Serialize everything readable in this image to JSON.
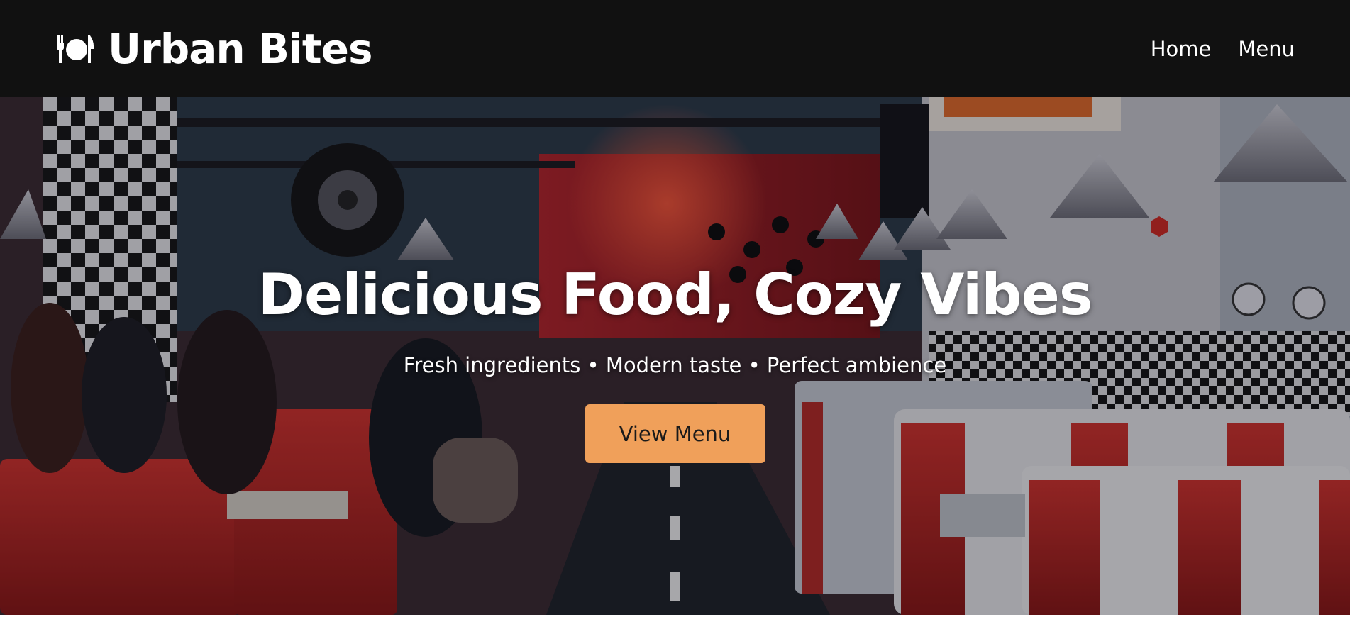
{
  "brand": {
    "name": "Urban Bites",
    "icon": "plate-cutlery-icon"
  },
  "nav": {
    "links": [
      {
        "label": "Home"
      },
      {
        "label": "Menu"
      }
    ]
  },
  "hero": {
    "title": "Delicious Food, Cozy Vibes",
    "subtitle": "Fresh ingredients • Modern taste • Perfect ambience",
    "cta_label": "View Menu",
    "background": "retro diner interior photo"
  },
  "colors": {
    "navbar_bg": "#111111",
    "text": "#ffffff",
    "cta_bg": "#f0a05a",
    "cta_text": "#1a1a1a"
  }
}
